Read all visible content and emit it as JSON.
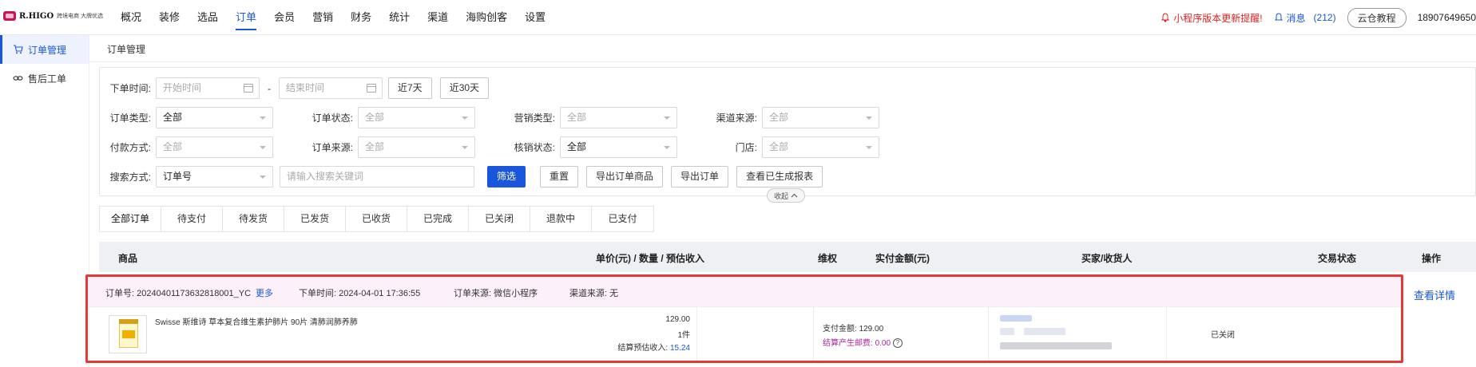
{
  "brand": {
    "name": "R.HIGO",
    "tagline": "跨境电商 大牌优选"
  },
  "nav": [
    "概况",
    "装修",
    "选品",
    "订单",
    "会员",
    "营销",
    "财务",
    "统计",
    "渠道",
    "海购创客",
    "设置"
  ],
  "nav_active": "订单",
  "top_right": {
    "notice": "小程序版本更新提醒!",
    "messages_label": "消息",
    "messages_count": "(212)",
    "cloud_btn": "云仓教程",
    "phone": "18907649650"
  },
  "sidebar": [
    "订单管理",
    "售后工单"
  ],
  "breadcrumb": "订单管理",
  "filters": {
    "order_time_label": "下单时间:",
    "start_placeholder": "开始时间",
    "dash": "-",
    "end_placeholder": "结束时间",
    "last7": "近7天",
    "last30": "近30天",
    "order_type": {
      "label": "订单类型:",
      "value": "全部"
    },
    "order_status": {
      "label": "订单状态:",
      "value": "全部"
    },
    "marketing_type": {
      "label": "营销类型:",
      "value": "全部"
    },
    "channel_source": {
      "label": "渠道来源:",
      "value": "全部"
    },
    "pay_method": {
      "label": "付款方式:",
      "value": "全部"
    },
    "order_source": {
      "label": "订单来源:",
      "value": "全部"
    },
    "verify_status": {
      "label": "核销状态:",
      "value": "全部"
    },
    "store": {
      "label": "门店:",
      "value": "全部"
    },
    "search_method": {
      "label": "搜索方式:",
      "value": "订单号"
    },
    "search_placeholder": "请输入搜索关键词",
    "buttons": [
      "筛选",
      "重置",
      "导出订单商品",
      "导出订单",
      "查看已生成报表"
    ],
    "collapse": "收起"
  },
  "tabs": [
    "全部订单",
    "待支付",
    "待发货",
    "已发货",
    "已收货",
    "已完成",
    "已关闭",
    "退款中",
    "已支付"
  ],
  "tab_active": "全部订单",
  "columns": [
    "商品",
    "单价(元) / 数量 / 预估收入",
    "维权",
    "实付金额(元)",
    "买家/收货人",
    "交易状态",
    "操作"
  ],
  "order": {
    "order_no_label": "订单号:",
    "order_no": "20240401173632818001_YC",
    "more": "更多",
    "time_label": "下单时间:",
    "time": "2024-04-01 17:36:55",
    "source_label": "订单来源:",
    "source": "微信小程序",
    "channel_label": "渠道来源:",
    "channel": "无",
    "product_name": "Swisse 斯维诗 草本复合维生素护肺片 90片 清肺润肺养肺",
    "unit_price": "129.00",
    "quantity": "1件",
    "est_income_label": "结算预估收入:",
    "est_income": "15.24",
    "paid_label": "支付金额:",
    "paid": "129.00",
    "fee_label": "结算产生邮费:",
    "fee": "0.00",
    "status": "已关闭",
    "action": "查看详情"
  },
  "colors": {
    "accent": "#1a56db",
    "alert": "#e02424",
    "highlight_border": "#e53935",
    "order_head_bg": "#fcf0fa"
  }
}
